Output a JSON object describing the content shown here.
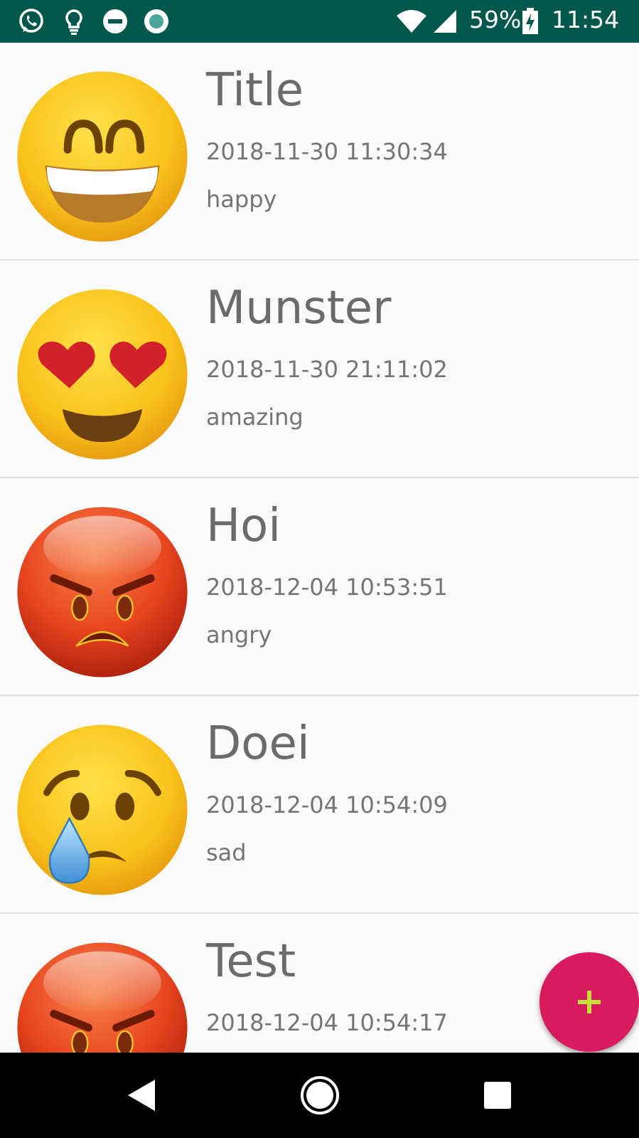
{
  "status_bar": {
    "battery_percent": "59%",
    "time": "11:54",
    "left_icons": [
      "whatsapp-icon",
      "lightbulb-icon",
      "do-not-disturb-icon",
      "record-icon"
    ],
    "right_icons": [
      "wifi-icon",
      "signal-icon",
      "battery-charging-icon"
    ]
  },
  "entries": [
    {
      "title": "Title",
      "date": "2018-11-30 11:30:34",
      "mood": "happy",
      "icon": "happy-face-icon"
    },
    {
      "title": "Munster",
      "date": "2018-11-30 21:11:02",
      "mood": "amazing",
      "icon": "heart-eyes-face-icon"
    },
    {
      "title": "Hoi",
      "date": "2018-12-04 10:53:51",
      "mood": "angry",
      "icon": "angry-face-icon"
    },
    {
      "title": "Doei",
      "date": "2018-12-04 10:54:09",
      "mood": "sad",
      "icon": "crying-face-icon"
    },
    {
      "title": "Test",
      "date": "2018-12-04 10:54:17",
      "mood": "",
      "icon": "angry-face-icon"
    }
  ],
  "fab": {
    "icon": "plus-icon",
    "color": "#d81b60",
    "icon_color": "#c6e03a"
  },
  "nav_bar": {
    "buttons": [
      "back-icon",
      "home-icon",
      "recents-icon"
    ]
  },
  "colors": {
    "status_bar": "#00574b",
    "background": "#fafafa",
    "text": "#757575"
  }
}
